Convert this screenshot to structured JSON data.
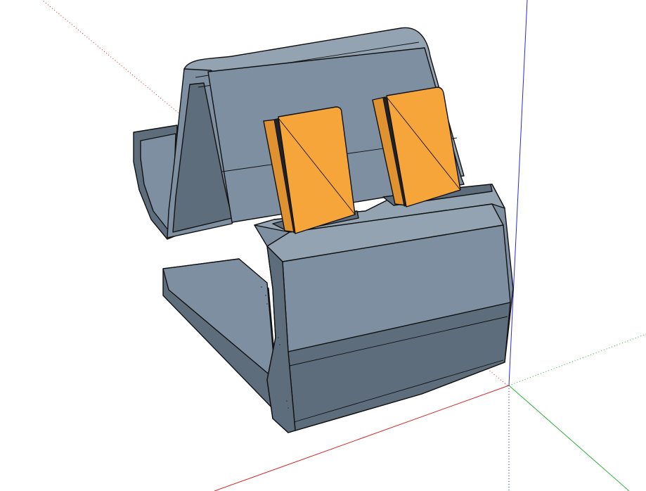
{
  "viewport": {
    "background": "#ffffff"
  },
  "axes": {
    "red_color": "#d42a2a",
    "green_color": "#2fae3a",
    "blue_color": "#2a2ad6"
  },
  "model": {
    "body_color": "#7d8fa0",
    "body_dark_color": "#5d6d7c",
    "body_light_color": "#93a3b2",
    "edge_color": "#111111",
    "prong_color": "#f5a53a",
    "prong_side_color": "#e09230"
  }
}
